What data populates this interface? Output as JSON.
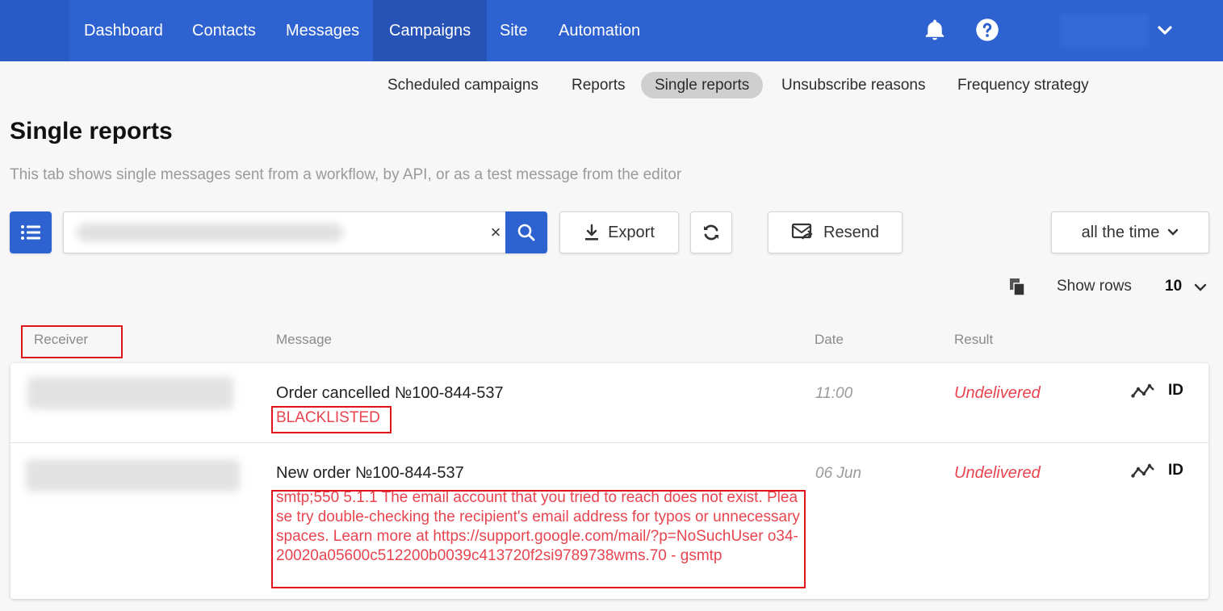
{
  "nav": {
    "items": [
      {
        "label": "Dashboard"
      },
      {
        "label": "Contacts"
      },
      {
        "label": "Messages"
      },
      {
        "label": "Campaigns"
      },
      {
        "label": "Site"
      },
      {
        "label": "Automation"
      }
    ],
    "active": "Campaigns",
    "icons": [
      "bell-icon",
      "help-icon",
      "chevron-down-icon"
    ]
  },
  "subtabs": [
    {
      "label": "Scheduled campaigns"
    },
    {
      "label": "Reports"
    },
    {
      "label": "Single reports"
    },
    {
      "label": "Unsubscribe reasons"
    },
    {
      "label": "Frequency strategy"
    }
  ],
  "page": {
    "title": "Single reports",
    "description": "This tab shows single messages sent from a workflow, by API, or as a test message from the editor"
  },
  "toolbar": {
    "search_value": "",
    "clear_symbol": "×",
    "export_label": "Export",
    "resend_label": "Resend",
    "period_label": "all the time",
    "show_rows_label": "Show rows",
    "rows_value": "10"
  },
  "table": {
    "headers": {
      "receiver": "Receiver",
      "message": "Message",
      "date": "Date",
      "result": "Result"
    },
    "rows": [
      {
        "message": "Order cancelled №100-844-537",
        "status": "BLACKLISTED",
        "date": "11:00",
        "result": "Undelivered",
        "id_label": "ID"
      },
      {
        "message": "New order №100-844-537",
        "status": "smtp;550 5.1.1 The email account that you tried to reach does not exist. Please try double-checking the recipient's email address for typos or unnecessary spaces. Learn more at https://support.google.com/mail/?p=NoSuchUser o34-20020a05600c512200b0039c413720f2si9789738wms.70 - gsmtp",
        "date": "06 Jun",
        "result": "Undelivered",
        "id_label": "ID"
      }
    ]
  },
  "colors": {
    "brand": "#2e62d0",
    "error": "#e8444f",
    "highlight": "#e0141b"
  }
}
